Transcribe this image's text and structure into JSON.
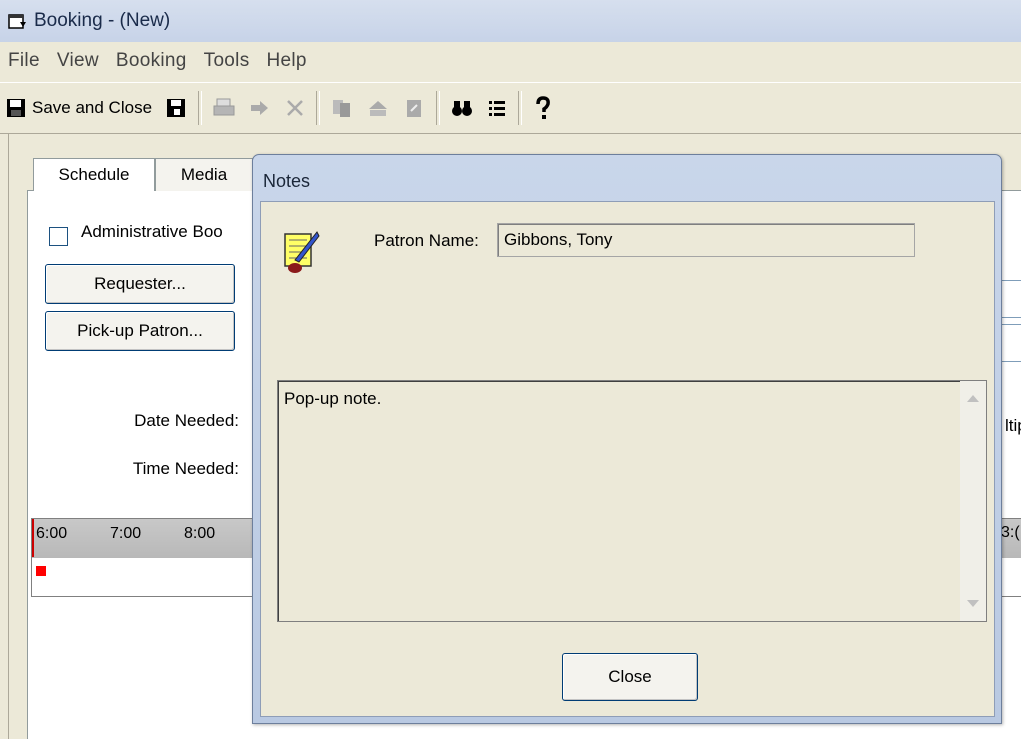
{
  "window": {
    "title": "Booking - (New)"
  },
  "menu": [
    "File",
    "View",
    "Booking",
    "Tools",
    "Help"
  ],
  "toolbar": {
    "save_close_label": "Save and Close"
  },
  "tabs": [
    "Schedule",
    "Media"
  ],
  "schedule": {
    "admin_label": "Administrative Boo",
    "requester_button": "Requester...",
    "pickup_button": "Pick-up Patron...",
    "date_label": "Date Needed:",
    "time_label": "Time Needed:",
    "timeline_hours": [
      "6:00",
      "7:00",
      "8:00"
    ],
    "right_partial": "ltip",
    "right_timeline": "3:("
  },
  "notes": {
    "title": "Notes",
    "patron_label": "Patron Name:",
    "patron_value": "Gibbons, Tony",
    "note_text": "Pop-up note.",
    "close_button": "Close"
  }
}
